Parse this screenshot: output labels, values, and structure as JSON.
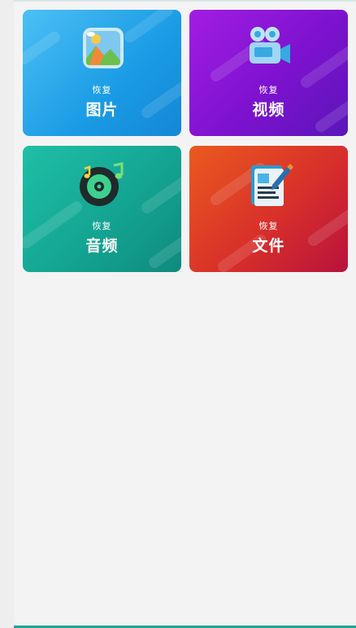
{
  "cards": [
    {
      "id": "photo",
      "small": "恢复",
      "big": "图片",
      "icon": "photo-gallery-icon"
    },
    {
      "id": "video",
      "small": "恢复",
      "big": "视频",
      "icon": "video-camera-icon"
    },
    {
      "id": "audio",
      "small": "恢复",
      "big": "音频",
      "icon": "music-disc-icon"
    },
    {
      "id": "file",
      "small": "恢复",
      "big": "文件",
      "icon": "document-edit-icon"
    }
  ],
  "colors": {
    "photo": "#1a9be4",
    "video": "#7d12cf",
    "audio": "#14a592",
    "file": "#d8302a",
    "bottom_bar": "#1fa39a"
  }
}
